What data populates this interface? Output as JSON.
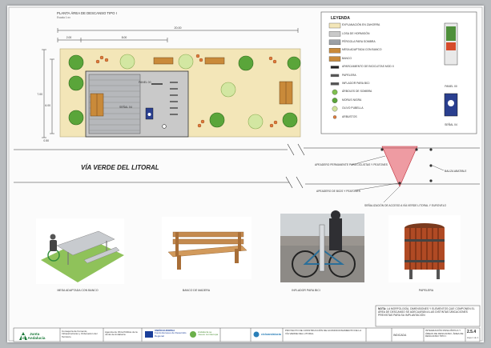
{
  "sheet": {
    "plan_title": "PLANTA ÁREA DE DESCANSO TIPO I",
    "plan_scale": "Escala 1:xx"
  },
  "dimensions": {
    "total_length": "20.00",
    "left_segment": "2.00",
    "middle_segment": "8.00",
    "height_outer": "7.00",
    "height_inner": "6.00",
    "bottom_offset": "0.50"
  },
  "plan_labels": {
    "panel": "PANEL 00",
    "signal": "SEÑAL 04"
  },
  "legend": {
    "title": "LEYENDA",
    "items": [
      {
        "label": "EXPLANACIÓN EN ZAHORRA",
        "swatch": "#f3e6b8"
      },
      {
        "label": "LOSA DE HORMIGÓN",
        "swatch": "#c9c9c9"
      },
      {
        "label": "PÉRGOLA PARA SOMBRA",
        "swatch": "#9aa0a6"
      },
      {
        "label": "MESA ADAPTADA CON BANCO",
        "swatch": "#c98a3a"
      },
      {
        "label": "BANCO",
        "swatch": "#c98a3a"
      },
      {
        "label": "APARCAMIENTO DE BICICLETAS MOD II",
        "swatch": "#222222"
      },
      {
        "label": "PAPELERA",
        "swatch": "#555555"
      },
      {
        "label": "INFLADOR PARA BICI",
        "swatch": "#555555"
      },
      {
        "label": "ÁRBOLES DE SOMBRA",
        "swatch": "#7fbf4f"
      },
      {
        "label": "MORUS NIGRA",
        "swatch": "#5aa53a"
      },
      {
        "label": "OLIVO PUBELLA",
        "swatch": "#cfe39a"
      },
      {
        "label": "ARBUSTOS",
        "swatch": "#e07b3a"
      }
    ],
    "panel_caption": "PANEL 00",
    "signal_caption": "SEÑAL 04"
  },
  "road": {
    "name": "VÍA VERDE DEL LITORAL",
    "callouts": [
      "APEADERO PERMANENTE PARA CICLISTAS Y PEATONES",
      "APEADERO DE BICIS Y PEATONES",
      "SEÑALIZACIÓN DE ACCESO A VÍA VERDE LITORAL Y EUROVELO",
      "BALIZA ABATIBLE"
    ]
  },
  "photos": [
    {
      "caption": "MESA ADAPTADA CON BANCO"
    },
    {
      "caption": "BANCO DE MADERA"
    },
    {
      "caption": "INFLADOR PARA BICI"
    },
    {
      "caption": "PAPELERA"
    }
  ],
  "note": {
    "heading": "NOTA:",
    "text": "LA MORFOLOGÍA, DIMENSIONES Y ELEMENTOS QUE COMPONEN EL ÁREA DE DESCANSO SE ADECUARÁN A LAS DISTINTAS UBICACIONES PREVISTAS PARA SU IMPLANTACIÓN"
  },
  "title_block": {
    "org_name_1": "Junta",
    "org_name_2": "de Andalucía",
    "department": "Consejería de Fomento, Infraestructuras y Ordenación del Territorio",
    "agency": "Agencia de Obra Pública de la Junta de Andalucía",
    "eu_fund": "UNIÓN EUROPEA",
    "eu_fund_sub": "Fondo Europeo de Desarrollo Regional",
    "eu_motto": "Andalucía se mueve con Europa",
    "partner": "cicloandalucía",
    "project_title": "PROYECTO DE CONSTRUCCIÓN DE ACONDICIONAMIENTO DE LA VÍA VERDE DEL LITORAL",
    "sheet_label": "INDICADA",
    "plan_name": "INTEGRACIÓN PAISAJÍSTICA Y ÁREAS DE DESCANSO. ÁREA DE DESCANSO TIPO I",
    "sheet_number": "2.5.4",
    "sheet_sub": "Hoja 1 de 1"
  },
  "colors": {
    "gravel": "#f3e6b8",
    "slab": "#c9c9c9",
    "pergola": "#9aa0a6",
    "wood": "#c98a3a",
    "tree_dark": "#5aa53a",
    "tree_light": "#d3e7a2",
    "shrub": "#e07b3a",
    "sign_blue": "#2a3f8f",
    "cone_red": "#e34d5a"
  }
}
